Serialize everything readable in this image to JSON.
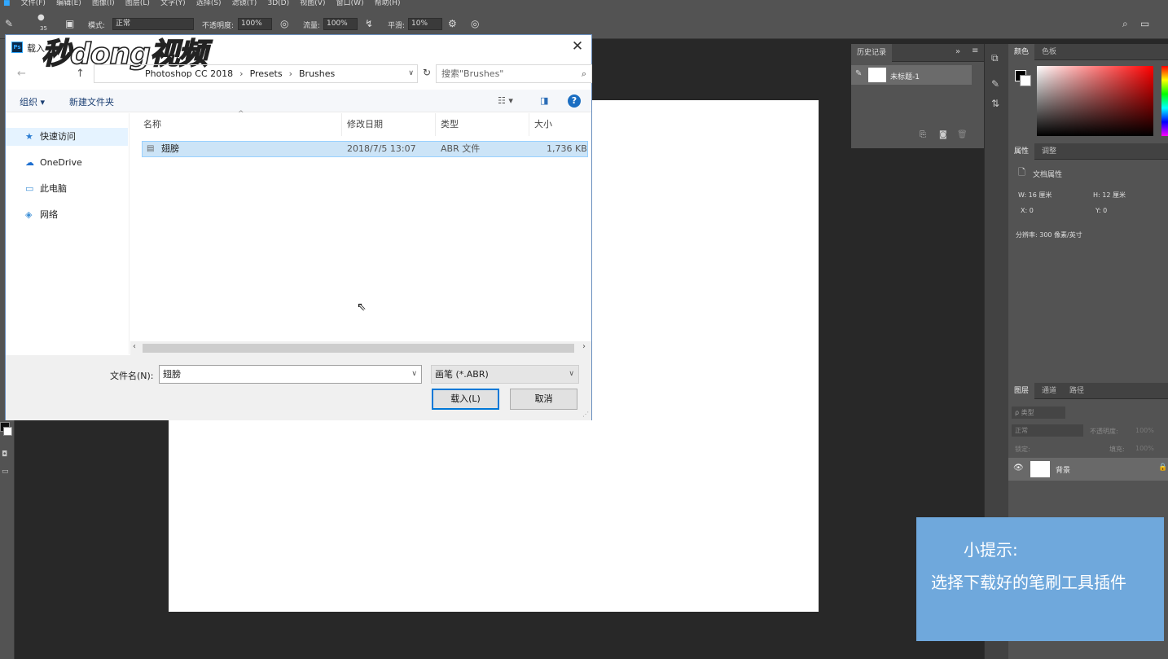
{
  "ps": {
    "menu": [
      "文件(F)",
      "编辑(E)",
      "图像(I)",
      "图层(L)",
      "文字(Y)",
      "选择(S)",
      "滤镜(T)",
      "3D(D)",
      "视图(V)",
      "窗口(W)",
      "帮助(H)"
    ],
    "options": {
      "brush_size": "35",
      "mode_label": "模式:",
      "mode_value": "正常",
      "opacity_label": "不透明度:",
      "opacity_value": "100%",
      "flow_label": "流量:",
      "flow_value": "100%",
      "smooth_label": "平滑:",
      "smooth_value": "10%"
    },
    "history": {
      "tab": "历史记录",
      "item": "未标题-1"
    },
    "color_panel": {
      "tab1": "颜色",
      "tab2": "色板"
    },
    "properties": {
      "tab1": "属性",
      "tab2": "调整",
      "title": "文档属性",
      "w": "W:  16 厘米",
      "h": "H:  12 厘米",
      "x": "X:  0",
      "y": "Y:  0",
      "resolution": "分辨率: 300 像素/英寸"
    },
    "layers": {
      "tab1": "图层",
      "tab2": "通道",
      "tab3": "路径",
      "filter": "ρ 类型",
      "blend": "正常",
      "opacity_label": "不透明度:",
      "opacity_value": "100%",
      "lock_label": "锁定:",
      "fill_label": "填充:",
      "fill_value": "100%",
      "layer_name": "背景"
    }
  },
  "tip": {
    "line1": "小提示:",
    "line2": "选择下载好的笔刷工具插件"
  },
  "watermark": "秒dong视频",
  "dialog": {
    "title": "载入",
    "path": [
      "Photoshop CC 2018",
      "Presets",
      "Brushes"
    ],
    "search_placeholder": "搜索\"Brushes\"",
    "organize": "组织 ▾",
    "new_folder": "新建文件夹",
    "nav": [
      "快速访问",
      "OneDrive",
      "此电脑",
      "网络"
    ],
    "columns": [
      "名称",
      "修改日期",
      "类型",
      "大小"
    ],
    "file": {
      "name": "翅膀",
      "date": "2018/7/5 13:07",
      "type": "ABR 文件",
      "size": "1,736 KB"
    },
    "filename_label": "文件名(N):",
    "filename_value": "翅膀",
    "filetype": "画笔 (*.ABR)",
    "load_button": "载入(L)",
    "cancel_button": "取消"
  }
}
